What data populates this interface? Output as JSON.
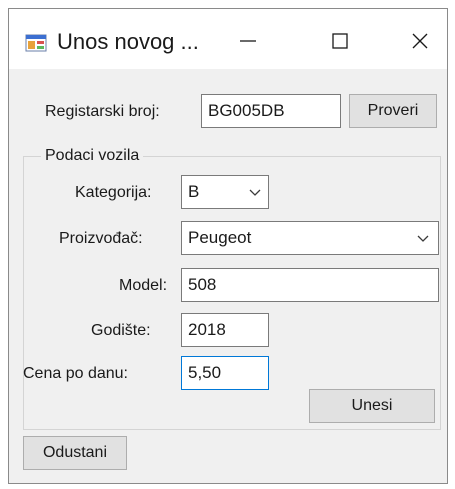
{
  "window": {
    "title": "Unos novog ...",
    "icon": "form-app-icon"
  },
  "title_buttons": {
    "minimize": "minimize-icon",
    "maximize": "maximize-icon",
    "close": "close-icon"
  },
  "registration": {
    "label": "Registarski broj:",
    "value": "BG005DB",
    "check_button": "Proveri"
  },
  "vehicle_group": {
    "title": "Podaci vozila",
    "category_label": "Kategorija:",
    "category_value": "B",
    "manufacturer_label": "Proizvođač:",
    "manufacturer_value": "Peugeot",
    "model_label": "Model:",
    "model_value": "508",
    "year_label": "Godište:",
    "year_value": "2018",
    "price_label": "Cena po danu:",
    "price_value": "5,50",
    "submit_button": "Unesi"
  },
  "cancel_button": "Odustani",
  "colors": {
    "focus_border": "#0078d7",
    "window_bg": "#f0f0f0"
  }
}
